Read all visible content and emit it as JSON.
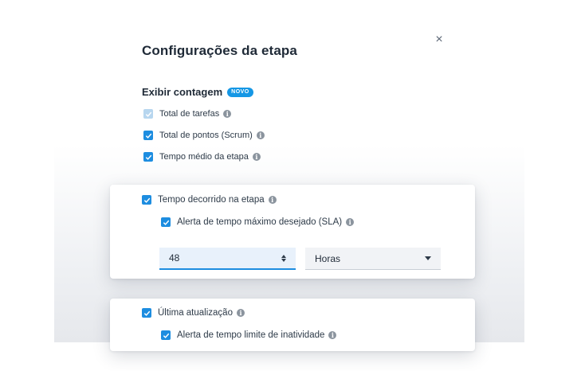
{
  "dialog": {
    "title": "Configurações da etapa",
    "close_glyph": "×"
  },
  "section": {
    "title": "Exibir contagem",
    "badge": "NOVO"
  },
  "options": [
    {
      "label": "Total de tarefas",
      "checked": true,
      "disabled": true
    },
    {
      "label": "Total de pontos (Scrum)",
      "checked": true,
      "disabled": false
    },
    {
      "label": "Tempo médio da etapa",
      "checked": true,
      "disabled": false
    }
  ],
  "elapsed_card": {
    "label": "Tempo decorrido na etapa",
    "checked": true,
    "sla": {
      "label": "Alerta de tempo máximo desejado (SLA)",
      "checked": true
    },
    "value_input": "48",
    "unit_select": "Horas"
  },
  "update_card": {
    "label": "Última atualização",
    "checked": true,
    "inactivity": {
      "label": "Alerta de tempo limite de inatividade",
      "checked": true
    }
  },
  "info_glyph": "i",
  "colors": {
    "accent": "#1d8de0",
    "badge": "#1597e5",
    "disabled_check": "#b7d6ef",
    "text": "#1f2a37"
  }
}
